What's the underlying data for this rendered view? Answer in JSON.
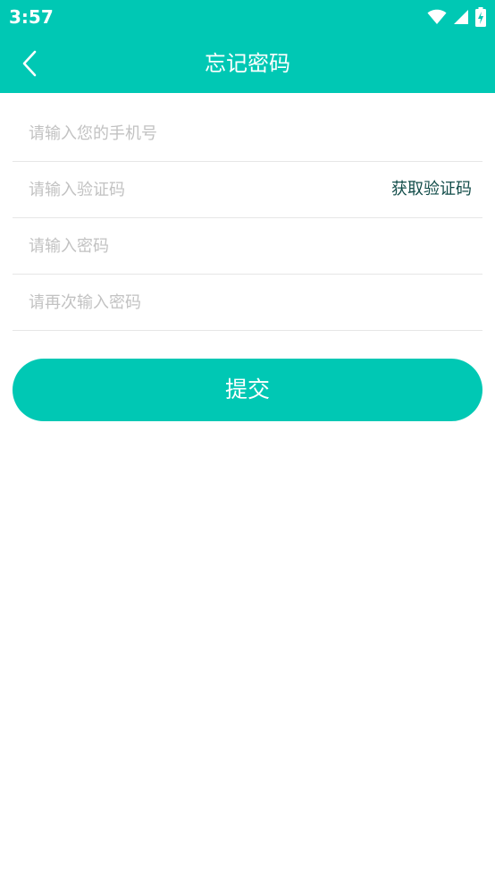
{
  "status_bar": {
    "time": "3:57",
    "icons": [
      "wifi-icon",
      "cellular-signal-icon",
      "battery-charging-icon"
    ]
  },
  "app_bar": {
    "back_icon": "chevron-left-icon",
    "title": "忘记密码"
  },
  "form": {
    "phone_placeholder": "请输入您的手机号",
    "code_placeholder": "请输入验证码",
    "get_code_label": "获取验证码",
    "password_placeholder": "请输入密码",
    "confirm_password_placeholder": "请再次输入密码"
  },
  "submit_label": "提交",
  "colors": {
    "primary": "#00c8b4",
    "link_text": "#134d4a",
    "placeholder": "#c2c2c2",
    "divider": "#e6e6e6"
  }
}
